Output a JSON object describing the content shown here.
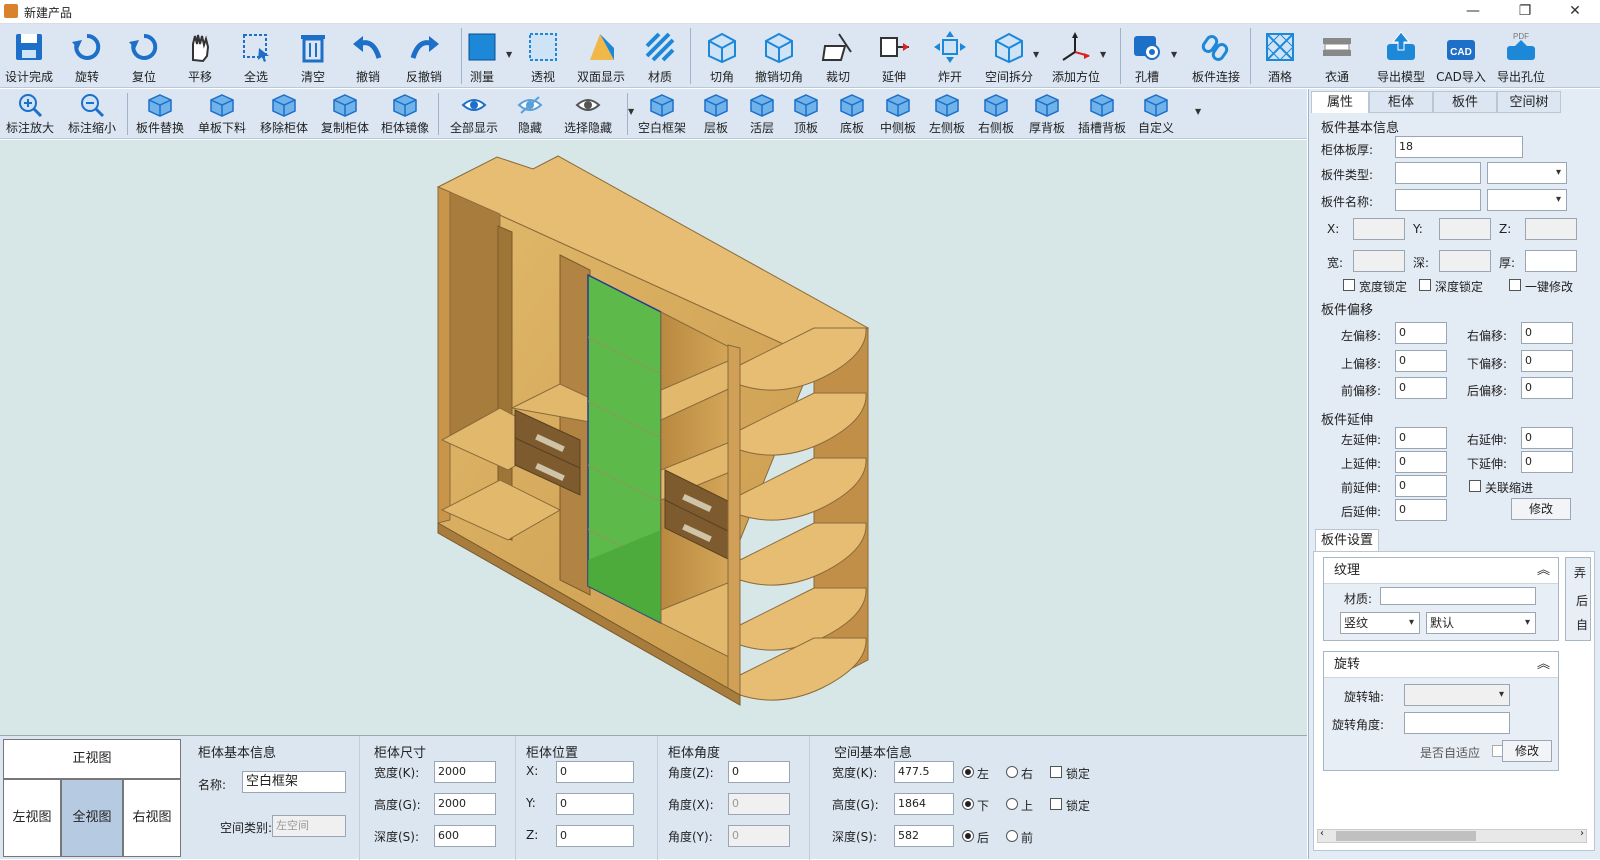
{
  "window": {
    "title": "新建产品",
    "minimize": "—",
    "restore": "❐",
    "close": "✕"
  },
  "toolbar_main": [
    {
      "label": "设计完成",
      "icon": "save-icon"
    },
    {
      "label": "旋转",
      "icon": "rotate-icon"
    },
    {
      "label": "复位",
      "icon": "reset-icon"
    },
    {
      "label": "平移",
      "icon": "hand-icon"
    },
    {
      "label": "全选",
      "icon": "select-all-icon"
    },
    {
      "label": "清空",
      "icon": "trash-icon"
    },
    {
      "label": "撤销",
      "icon": "undo-icon"
    },
    {
      "label": "反撤销",
      "icon": "redo-icon"
    },
    {
      "label": "测量",
      "icon": "measure-icon"
    },
    {
      "label": "透视",
      "icon": "perspective-icon"
    },
    {
      "label": "双面显示",
      "icon": "double-side-icon"
    },
    {
      "label": "材质",
      "icon": "material-icon"
    },
    {
      "label": "切角",
      "icon": "chamfer-icon"
    },
    {
      "label": "撤销切角",
      "icon": "undo-chamfer-icon"
    },
    {
      "label": "裁切",
      "icon": "trim-icon"
    },
    {
      "label": "延伸",
      "icon": "extend-icon"
    },
    {
      "label": "炸开",
      "icon": "explode-icon"
    },
    {
      "label": "空间拆分",
      "icon": "space-split-icon"
    },
    {
      "label": "添加方位",
      "icon": "axis-icon"
    },
    {
      "label": "孔槽",
      "icon": "hole-icon"
    },
    {
      "label": "板件连接",
      "icon": "link-icon"
    },
    {
      "label": "酒格",
      "icon": "wine-rack-icon"
    },
    {
      "label": "衣通",
      "icon": "hanger-rail-icon"
    },
    {
      "label": "导出模型",
      "icon": "export-model-icon"
    },
    {
      "label": "CAD导入",
      "icon": "cad-import-icon"
    },
    {
      "label": "导出孔位",
      "icon": "pdf-export-icon"
    }
  ],
  "toolbar_secondary": [
    {
      "label": "标注放大",
      "icon": "zoom-in-icon"
    },
    {
      "label": "标注缩小",
      "icon": "zoom-out-icon"
    },
    {
      "label": "板件替换",
      "icon": "panel-replace-icon"
    },
    {
      "label": "单板下料",
      "icon": "single-board-icon"
    },
    {
      "label": "移除柜体",
      "icon": "remove-cabinet-icon"
    },
    {
      "label": "复制柜体",
      "icon": "copy-cabinet-icon"
    },
    {
      "label": "柜体镜像",
      "icon": "mirror-icon"
    },
    {
      "label": "全部显示",
      "icon": "eye-icon"
    },
    {
      "label": "隐藏",
      "icon": "hide-icon"
    },
    {
      "label": "选择隐藏",
      "icon": "select-hide-icon"
    },
    {
      "label": "空白框架",
      "icon": "blank-frame-icon"
    },
    {
      "label": "层板",
      "icon": "shelf-icon"
    },
    {
      "label": "活层",
      "icon": "movable-shelf-icon"
    },
    {
      "label": "顶板",
      "icon": "top-board-icon"
    },
    {
      "label": "底板",
      "icon": "bottom-board-icon"
    },
    {
      "label": "中侧板",
      "icon": "middle-side-icon"
    },
    {
      "label": "左侧板",
      "icon": "left-side-icon"
    },
    {
      "label": "右侧板",
      "icon": "right-side-icon"
    },
    {
      "label": "厚背板",
      "icon": "thick-back-icon"
    },
    {
      "label": "插槽背板",
      "icon": "slot-back-icon"
    },
    {
      "label": "自定义",
      "icon": "custom-icon"
    }
  ],
  "views": {
    "front": "正视图",
    "left": "左视图",
    "full": "全视图",
    "right": "右视图"
  },
  "cabinet_info": {
    "title": "柜体基本信息",
    "name_label": "名称:",
    "name_value": "空白框架",
    "type_label": "空间类别:",
    "type_value": "左空间"
  },
  "cabinet_size": {
    "title": "柜体尺寸",
    "width_label": "宽度(K):",
    "width": "2000",
    "height_label": "高度(G):",
    "height": "2000",
    "depth_label": "深度(S):",
    "depth": "600"
  },
  "cabinet_pos": {
    "title": "柜体位置",
    "x_label": "X:",
    "x": "0",
    "y_label": "Y:",
    "y": "0",
    "z_label": "Z:",
    "z": "0"
  },
  "cabinet_angle": {
    "title": "柜体角度",
    "z_label": "角度(Z):",
    "z": "0",
    "x_label": "角度(X):",
    "x": "0",
    "y_label": "角度(Y):",
    "y": "0"
  },
  "space_info": {
    "title": "空间基本信息",
    "width_label": "宽度(K):",
    "width": "477.5",
    "height_label": "高度(G):",
    "height": "1864",
    "depth_label": "深度(S):",
    "depth": "582",
    "r_left": "左",
    "r_right": "右",
    "r_down": "下",
    "r_up": "上",
    "r_back": "后",
    "r_front": "前",
    "lock": "锁定"
  },
  "panel": {
    "tabs": [
      "属性",
      "柜体",
      "板件",
      "空间树"
    ],
    "basic_title": "板件基本信息",
    "thickness_label": "柜体板厚:",
    "thickness": "18",
    "type_label": "板件类型:",
    "name_label": "板件名称:",
    "x_label": "X:",
    "y_label": "Y:",
    "z_label": "Z:",
    "w_label": "宽:",
    "d_label": "深:",
    "t_label": "厚:",
    "lock_width": "宽度锁定",
    "lock_depth": "深度锁定",
    "one_key": "一键修改",
    "offset_title": "板件偏移",
    "off_left_label": "左偏移:",
    "off_left": "0",
    "off_right_label": "右偏移:",
    "off_right": "0",
    "off_top_label": "上偏移:",
    "off_top": "0",
    "off_bottom_label": "下偏移:",
    "off_bottom": "0",
    "off_front_label": "前偏移:",
    "off_front": "0",
    "off_back_label": "后偏移:",
    "off_back": "0",
    "ext_title": "板件延伸",
    "ext_left_label": "左延伸:",
    "ext_left": "0",
    "ext_right_label": "右延伸:",
    "ext_right": "0",
    "ext_top_label": "上延伸:",
    "ext_top": "0",
    "ext_bottom_label": "下延伸:",
    "ext_bottom": "0",
    "ext_front_label": "前延伸:",
    "ext_front": "0",
    "linked_shrink": "关联缩进",
    "ext_back_label": "后延伸:",
    "ext_back": "0",
    "modify": "修改",
    "settings_tab": "板件设置",
    "texture_title": "纹理",
    "material_label": "材质:",
    "grain": "竖纹",
    "grain_default": "默认",
    "rotate_title": "旋转",
    "rotate_axis_label": "旋转轴:",
    "rotate_angle_label": "旋转角度:",
    "adaptive_label": "是否自适应",
    "modify2": "修改",
    "side_box_chars": [
      "弄",
      "后",
      "自"
    ]
  },
  "colors": {
    "toolbar": "#dbe6f2",
    "viewport": "#d7e7e8",
    "wood": "#d8a95a",
    "highlight": "#5cb94a"
  }
}
